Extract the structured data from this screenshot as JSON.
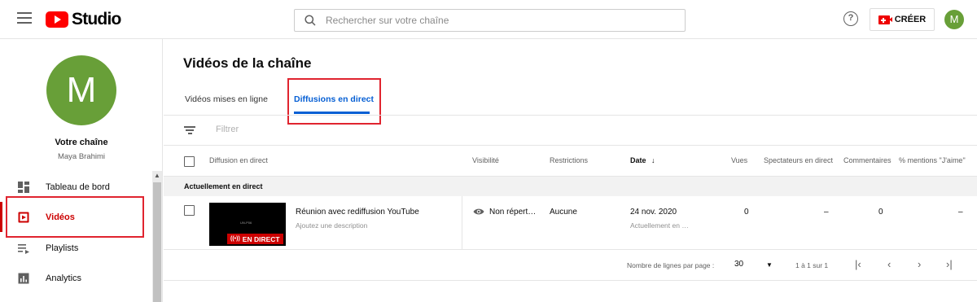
{
  "header": {
    "logo_text": "Studio",
    "search_placeholder": "Rechercher sur votre chaîne",
    "help_label": "?",
    "create_label": "CRÉER",
    "avatar_letter": "M"
  },
  "sidebar": {
    "avatar_letter": "M",
    "channel_title": "Votre chaîne",
    "channel_name": "Maya Brahimi",
    "items": [
      {
        "label": "Tableau de bord",
        "icon": "dashboard-icon",
        "active": false
      },
      {
        "label": "Vidéos",
        "icon": "videos-icon",
        "active": true
      },
      {
        "label": "Playlists",
        "icon": "playlists-icon",
        "active": false
      },
      {
        "label": "Analytics",
        "icon": "analytics-icon",
        "active": false
      }
    ]
  },
  "main": {
    "page_title": "Vidéos de la chaîne",
    "tabs": [
      {
        "label": "Vidéos mises en ligne",
        "active": false
      },
      {
        "label": "Diffusions en direct",
        "active": true
      }
    ],
    "filter_placeholder": "Filtrer",
    "columns": {
      "diffusion": "Diffusion en direct",
      "visibility": "Visibilité",
      "restrictions": "Restrictions",
      "date": "Date",
      "views": "Vues",
      "live_viewers": "Spectateurs en direct",
      "comments": "Commentaires",
      "likes": "% mentions \"J'aime\""
    },
    "section_label": "Actuellement en direct",
    "rows": [
      {
        "thumb_caption": "UN-P06",
        "live_badge": "EN DIRECT",
        "title": "Réunion avec rediffusion YouTube",
        "description": "Ajoutez une description",
        "visibility": "Non répert…",
        "restrictions": "Aucune",
        "date": "24 nov. 2020",
        "date_sub": "Actuellement en …",
        "views": "0",
        "live_viewers": "–",
        "comments": "0",
        "likes": "–"
      }
    ],
    "footer": {
      "rows_per_page_label": "Nombre de lignes par page :",
      "rows_per_page_value": "30",
      "range": "1 à 1 sur 1"
    }
  },
  "colors": {
    "brand_red": "#ff0000",
    "accent_blue": "#065fd4",
    "avatar_green": "#689f38",
    "highlight_red": "#e0242f"
  }
}
